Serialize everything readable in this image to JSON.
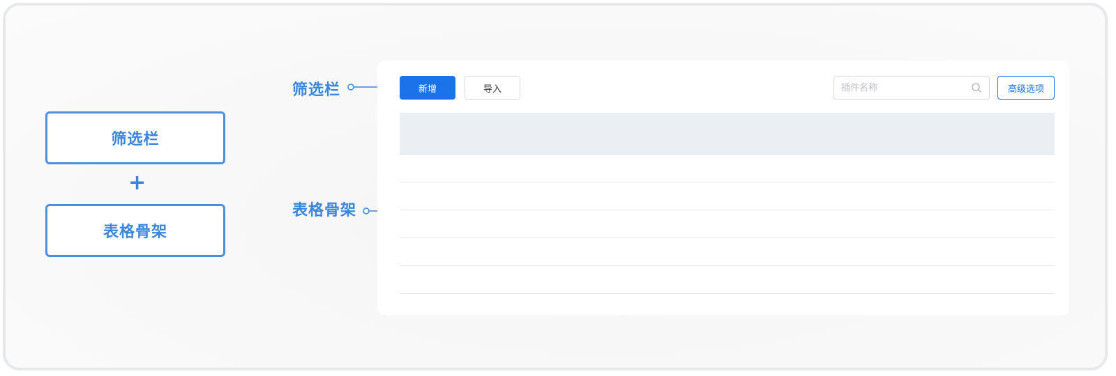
{
  "legend": {
    "filter_label": "筛选栏",
    "plus": "+",
    "table_label": "表格骨架"
  },
  "callouts": {
    "filter": "筛选栏",
    "table": "表格骨架"
  },
  "toolbar": {
    "add_label": "新增",
    "import_label": "导入",
    "search_placeholder": "插件名称",
    "search_value": "",
    "advanced_label": "高级选项"
  },
  "table": {
    "row_count": 5
  },
  "colors": {
    "accent": "#1a73e8",
    "annotation": "#3a86dd",
    "header_bg": "#ebeef2"
  }
}
